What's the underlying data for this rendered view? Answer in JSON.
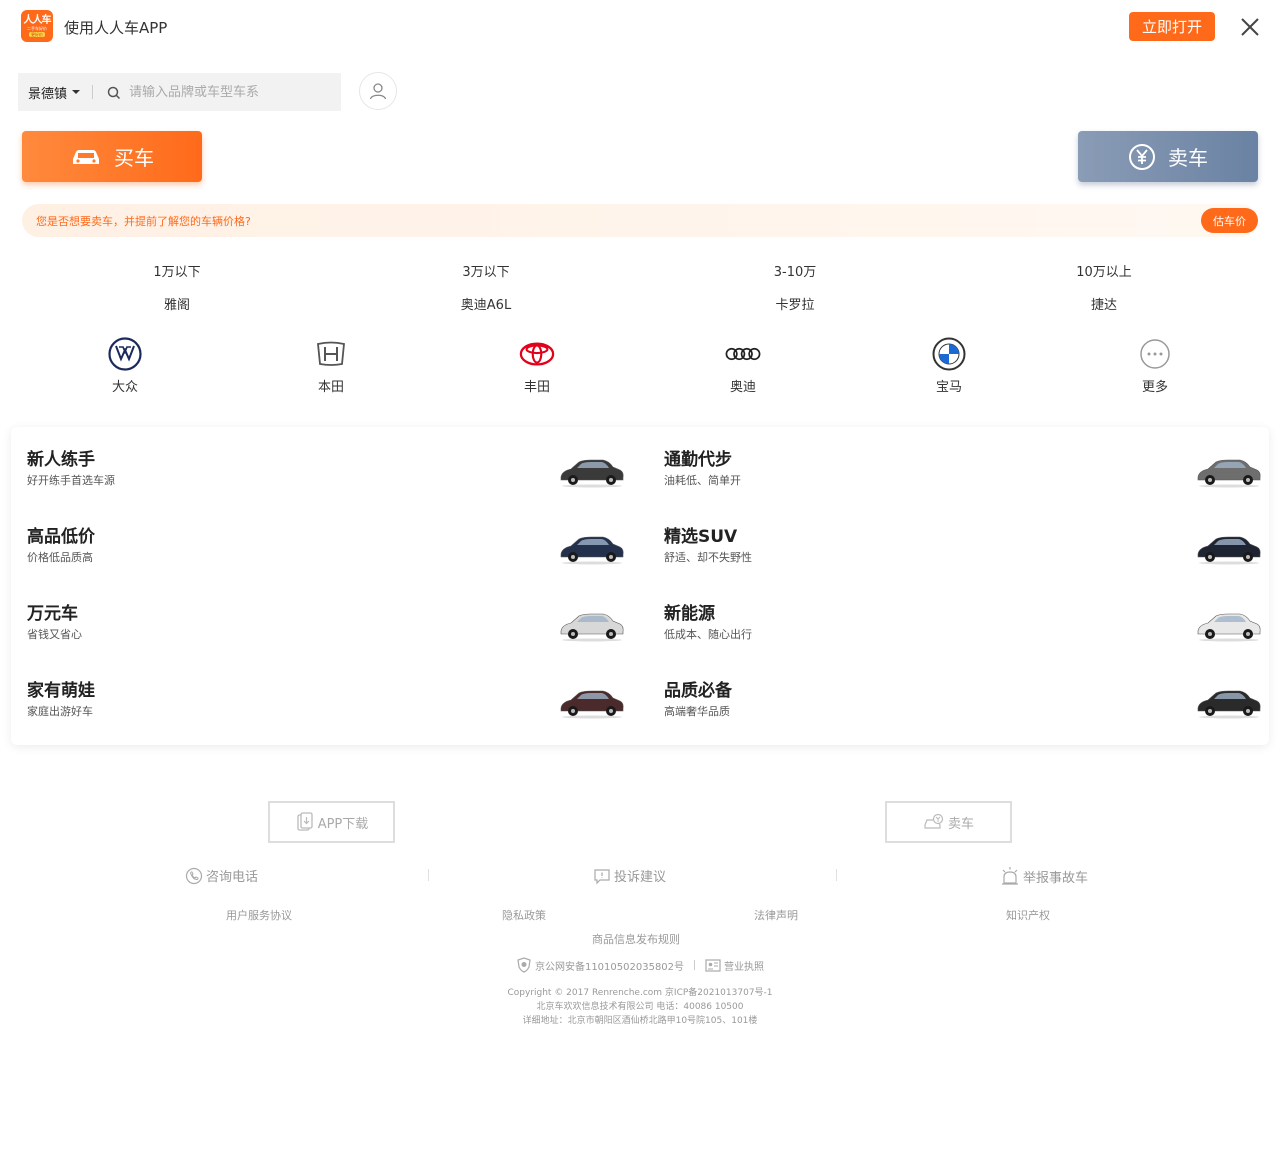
{
  "app_banner": {
    "logo": {
      "line1": "人人车",
      "line2": "二手车好价",
      "line3": "更好价"
    },
    "title": "使用人人车APP",
    "open_label": "立即打开",
    "close_icon": "close-icon"
  },
  "search": {
    "city": "景德镇",
    "placeholder": "请输入品牌或车型车系"
  },
  "actions": {
    "buy_label": "买车",
    "sell_label": "卖车"
  },
  "estimate": {
    "text": "您是否想要卖车，并提前了解您的车辆价格?",
    "button": "估车价"
  },
  "price_ranges": [
    {
      "label": "1万以下",
      "example": "雅阁"
    },
    {
      "label": "3万以下",
      "example": "奥迪A6L"
    },
    {
      "label": "3-10万",
      "example": "卡罗拉"
    },
    {
      "label": "10万以上",
      "example": "捷达"
    }
  ],
  "brands": [
    {
      "name": "大众",
      "icon": "volkswagen-logo-icon"
    },
    {
      "name": "本田",
      "icon": "honda-logo-icon"
    },
    {
      "name": "丰田",
      "icon": "toyota-logo-icon"
    },
    {
      "name": "奥迪",
      "icon": "audi-logo-icon"
    },
    {
      "name": "宝马",
      "icon": "bmw-logo-icon"
    },
    {
      "name": "更多",
      "icon": "more-icon"
    }
  ],
  "categories": [
    {
      "title": "新人练手",
      "subtitle": "好开练手首选车源",
      "car_color": "#3a3a3a"
    },
    {
      "title": "通勤代步",
      "subtitle": "油耗低、简单开",
      "car_color": "#6e6e6e"
    },
    {
      "title": "高品低价",
      "subtitle": "价格低品质高",
      "car_color": "#24314d"
    },
    {
      "title": "精选SUV",
      "subtitle": "舒适、却不失野性",
      "car_color": "#1f2433"
    },
    {
      "title": "万元车",
      "subtitle": "省钱又省心",
      "car_color": "#d8d8d8"
    },
    {
      "title": "新能源",
      "subtitle": "低成本、随心出行",
      "car_color": "#e8e8e8"
    },
    {
      "title": "家有萌娃",
      "subtitle": "家庭出游好车",
      "car_color": "#4a2a2a"
    },
    {
      "title": "品质必备",
      "subtitle": "高端奢华品质",
      "car_color": "#2a2a2a"
    }
  ],
  "footer": {
    "app_download": "APP下载",
    "sell": "卖车",
    "hotline": "咨询电话",
    "complaint": "投诉建议",
    "report": "举报事故车",
    "links": [
      "用户服务协议",
      "隐私政策",
      "法律声明",
      "知识产权"
    ],
    "info_rules": "商品信息发布规则",
    "police": "京公网安备11010502035802号",
    "license": "营业执照",
    "copyright": "Copyright © 2017 Renrenche.com 京ICP备2021013707号-1",
    "company": "北京车欢欢信息技术有限公司 电话：40086 10500",
    "address": "详细地址：北京市朝阳区酒仙桥北路甲10号院105、101楼"
  },
  "colors": {
    "accent": "#ff6a1a",
    "sell_gradient": "#7a8fae"
  }
}
